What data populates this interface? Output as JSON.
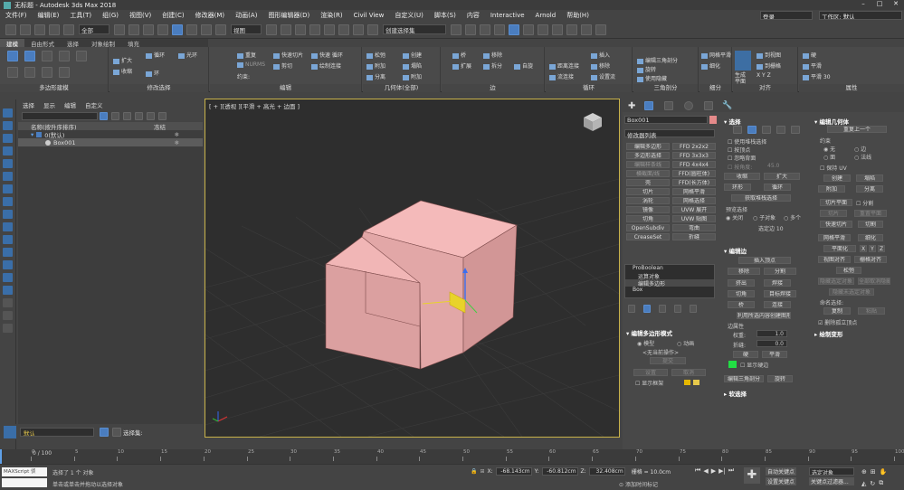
{
  "title": {
    "app": "无标题 - Autodesk 3ds Max 2018",
    "search": "键入关键字或短语",
    "login": "登录",
    "workspace": "工作区: 默认"
  },
  "menu": [
    "文件(F)",
    "编辑(E)",
    "工具(T)",
    "组(G)",
    "视图(V)",
    "创建(C)",
    "修改器(M)",
    "动画(A)",
    "图形编辑器(D)",
    "渲染(R)",
    "Civil View",
    "自定义(U)",
    "脚本(S)",
    "内容",
    "Interactive",
    "Arnold",
    "帮助(H)"
  ],
  "toolbar": {
    "filter": "全部",
    "view": "视图",
    "selset": "创建选择集"
  },
  "ribbon_tabs": [
    "建模",
    "自由形式",
    "选择",
    "对象绘制",
    "填充"
  ],
  "ribbon": {
    "groups": [
      "多边形建模",
      "修改选择",
      "编辑",
      "几何体(全部)",
      "边",
      "循环",
      "三角剖分",
      "细分",
      "对齐",
      "属性"
    ],
    "items": {
      "modsel": [
        "扩大",
        "收缩",
        "循环",
        "环",
        "光环"
      ],
      "edit": [
        "重复",
        "快速切片",
        "快速 循环",
        "NURMS",
        "剪切",
        "绘制连接",
        "约束:"
      ],
      "geom": [
        "松弛",
        "创建",
        "塌陷",
        "附加",
        "分离",
        "附加",
        "删除"
      ],
      "edge": [
        "桥",
        "扩展",
        "拆分",
        "移除",
        "自旋"
      ],
      "loop": [
        "距离连接",
        "流连接",
        "插入",
        "移除",
        "设置流"
      ],
      "tri": [
        "编辑三角剖分",
        "旋转",
        "使用隐藏"
      ],
      "subdiv": [
        "网格平滑",
        "细化"
      ],
      "align": [
        "生成",
        "平面",
        "到视图",
        "到栅格",
        "X Y Z"
      ],
      "props": [
        "硬",
        "平滑",
        "平滑 30"
      ]
    }
  },
  "explorer": {
    "menu": [
      "选择",
      "显示",
      "编辑",
      "自定义"
    ],
    "columns": [
      "名称(按升序排序)",
      "冻结"
    ],
    "rows": [
      "0(默认)",
      "Box001"
    ],
    "layer": "默认",
    "selection": "选择集:"
  },
  "viewport": {
    "label": "[ + ][透视 ][平滑 + 高光 + 边面 ]"
  },
  "cmd": {
    "objname": "Box001",
    "modlist": "修改器列表",
    "modbtns": [
      "编辑多边形",
      "FFD 2x2x2",
      "多边形选择",
      "FFD 3x3x3",
      "编辑样条线",
      "FFD 4x4x4",
      "横截面/线",
      "FFD(圆柱体)",
      "壳",
      "FFD(长方体)",
      "切片",
      "网格平滑",
      "涡轮",
      "网格选择",
      "镜像",
      "UVW 展开",
      "切角",
      "UVW 贴图",
      "OpenSubdiv",
      "弯曲",
      "CreaseSet",
      "折缝"
    ],
    "stack": [
      "ProBoolean",
      "运算对象",
      "编辑多边形",
      "Box"
    ],
    "polymode": {
      "title": "编辑多边形模式",
      "opts": [
        "模型",
        "动画"
      ],
      "noop": "<无当前操作>",
      "commit": "提交",
      "settings": "设置",
      "cancel": "取消",
      "showcage": "显示框架"
    },
    "select": {
      "title": "选择",
      "byvertex": "使用堆栈选择",
      "byvert": "按顶点",
      "ignore": "忽略背面",
      "angle": "按角度:",
      "angleval": "45.0",
      "shrink": "收缩",
      "grow": "扩大",
      "ring": "环形",
      "loop": "循环",
      "getstack": "获取堆栈选择",
      "preview": "预览选择",
      "off": "关闭",
      "subobj": "子对象",
      "multi": "多个",
      "selcount": "选定边 10"
    },
    "editedges": {
      "title": "编辑边",
      "insert": "插入顶点",
      "remove": "移除",
      "split": "分割",
      "extrude": "挤出",
      "weld": "焊接",
      "chamfer": "切角",
      "targetweld": "目标焊接",
      "bridge": "桥",
      "connect": "连接",
      "createshape": "利用所选内容创建图形",
      "weightlbl": "边属性",
      "weight": "权重:",
      "weightval": "1.0",
      "crease": "折缝:",
      "creaseval": "0.0",
      "hard": "硬",
      "smooth": "平滑",
      "display": "显示硬边",
      "edittri": "编辑三角剖分",
      "turn": "旋转"
    },
    "softsel": "软选择",
    "geom": {
      "title": "编辑几何体",
      "repeat": "重复上一个",
      "constraint": "约束",
      "none": "无",
      "edge": "边",
      "face": "面",
      "normal": "法线",
      "preserve": "保持 UV",
      "create": "创建",
      "collapse": "塌陷",
      "attach": "附加",
      "detach": "分离",
      "slicepl": "切片平面",
      "split": "分割",
      "slice": "切片",
      "resetpl": "重置平面",
      "qslice": "快速切片",
      "cut": "切割",
      "msmooth": "网格平滑",
      "tess": "细化",
      "planar": "平面化",
      "x": "X",
      "y": "Y",
      "z": "Z",
      "viewalign": "视图对齐",
      "gridalign": "栅格对齐",
      "relax": "松弛",
      "hidesel": "隐藏选定对象",
      "unhide": "全部取消隐藏",
      "hideunsel": "隐藏未选定对象",
      "namedsel": "命名选择:",
      "copy": "复制",
      "paste": "粘贴",
      "delisolated": "删除孤立顶点"
    },
    "paintdef": "绘制变形"
  },
  "timeline": {
    "frame": "0 / 100",
    "ticks": [
      "0",
      "5",
      "10",
      "15",
      "20",
      "25",
      "30",
      "35",
      "40",
      "45",
      "50",
      "55",
      "60",
      "65",
      "70",
      "75",
      "80",
      "85",
      "90",
      "95",
      "100"
    ]
  },
  "status": {
    "maxscript": "MAXScript 侦",
    "msg1": "选择了 1 个 对象",
    "msg2": "单击或单击并拖动以选择对象",
    "x": "-68.143cm",
    "y": "-60.812cm",
    "z": "32.408cm",
    "grid": "栅格 = 10.0cm",
    "addtag": "添加时间标记",
    "autokey": "自动关键点",
    "setkey": "设置关键点",
    "selobj": "选定对象",
    "keyfilt": "关键点过滤器..."
  }
}
